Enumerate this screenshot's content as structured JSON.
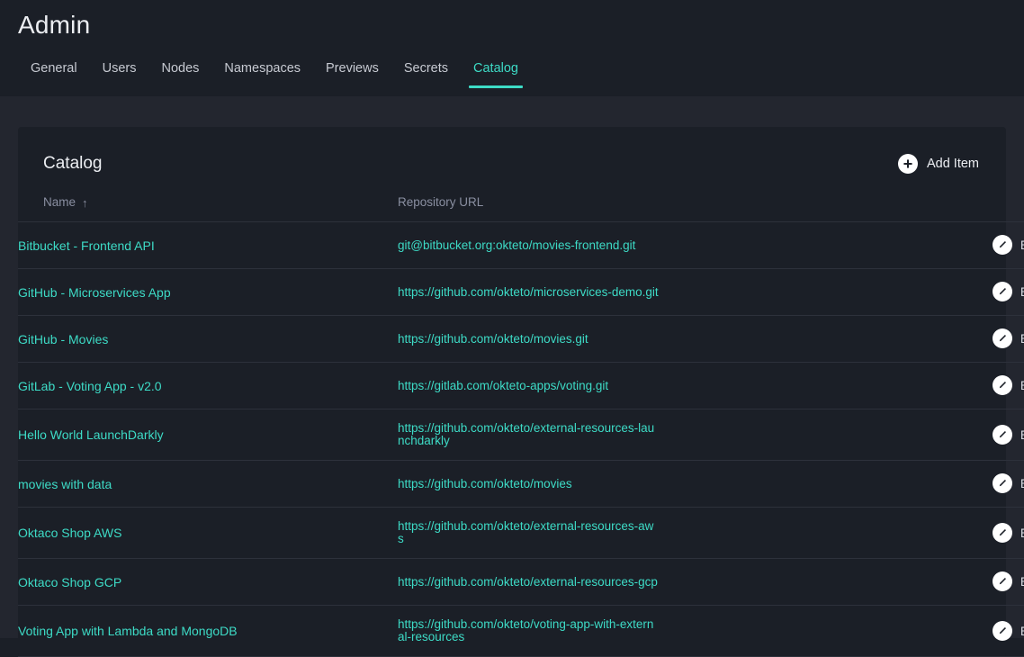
{
  "header": {
    "title": "Admin",
    "tabs": [
      {
        "label": "General",
        "active": false
      },
      {
        "label": "Users",
        "active": false
      },
      {
        "label": "Nodes",
        "active": false
      },
      {
        "label": "Namespaces",
        "active": false
      },
      {
        "label": "Previews",
        "active": false
      },
      {
        "label": "Secrets",
        "active": false
      },
      {
        "label": "Catalog",
        "active": true
      }
    ]
  },
  "card": {
    "title": "Catalog",
    "add_item_label": "Add Item",
    "add_icon": "plus-circle-icon",
    "columns": {
      "name": "Name",
      "url": "Repository URL",
      "sort_indicator": "↑"
    },
    "edit_label": "Edit",
    "edit_icon": "pencil-circle-icon",
    "rows": [
      {
        "name": "Bitbucket - Frontend API",
        "url": "git@bitbucket.org:okteto/movies-frontend.git"
      },
      {
        "name": "GitHub - Microservices App",
        "url": "https://github.com/okteto/microservices-demo.git"
      },
      {
        "name": "GitHub - Movies",
        "url": "https://github.com/okteto/movies.git"
      },
      {
        "name": "GitLab - Voting App - v2.0",
        "url": "https://gitlab.com/okteto-apps/voting.git"
      },
      {
        "name": "Hello World LaunchDarkly",
        "url": "https://github.com/okteto/external-resources-launchdarkly"
      },
      {
        "name": "movies with data",
        "url": "https://github.com/okteto/movies"
      },
      {
        "name": "Oktaco Shop AWS",
        "url": "https://github.com/okteto/external-resources-aws"
      },
      {
        "name": "Oktaco Shop GCP",
        "url": "https://github.com/okteto/external-resources-gcp"
      },
      {
        "name": "Voting App with Lambda and MongoDB",
        "url": "https://github.com/okteto/voting-app-with-external-resources"
      }
    ]
  },
  "colors": {
    "accent": "#3ddbc6",
    "header_bg": "#1b1f27",
    "page_bg": "#23262f",
    "card_bg": "#1b1f27",
    "divider": "#2d313b",
    "muted_text": "#8a8fa1"
  }
}
